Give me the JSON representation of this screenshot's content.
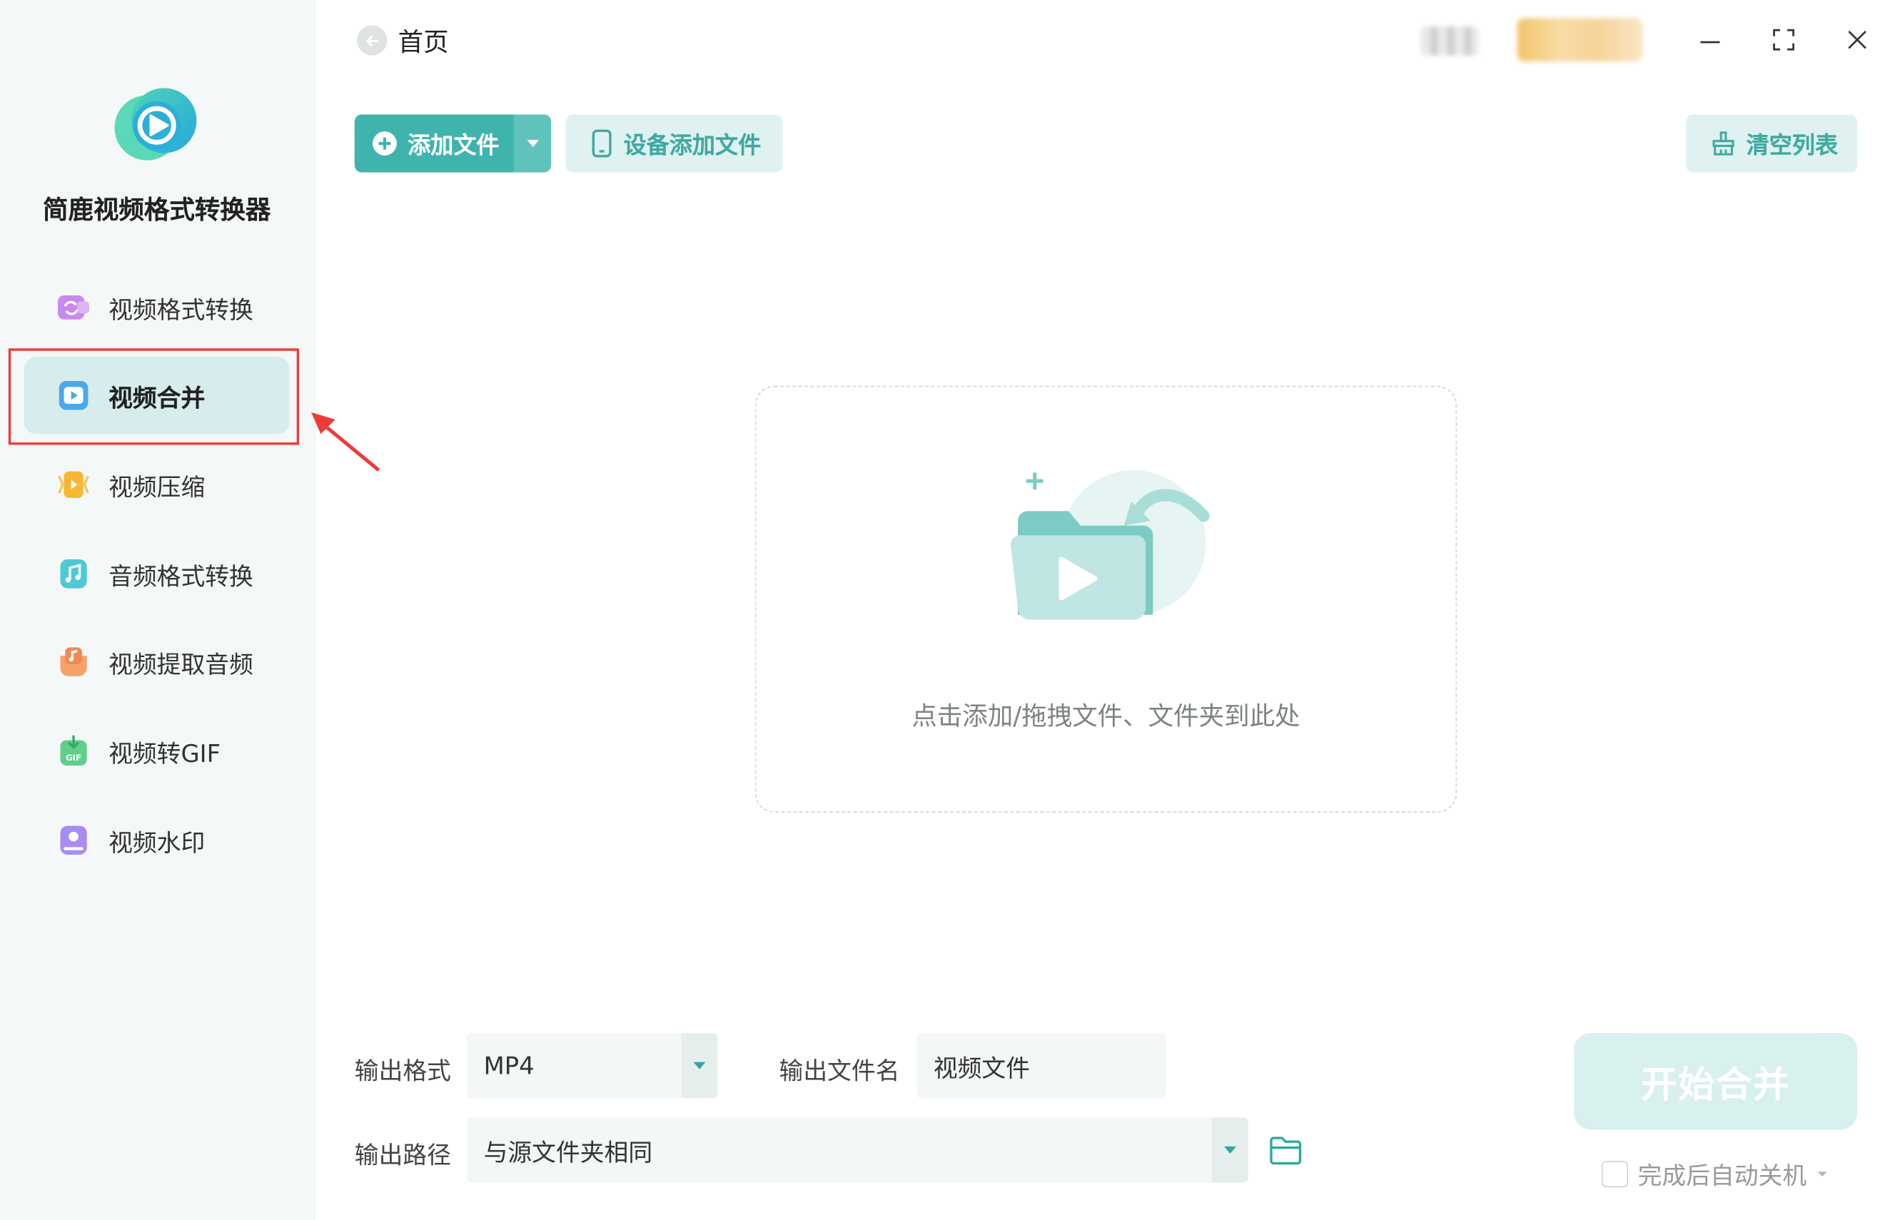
{
  "app": {
    "name": "简鹿视频格式转换器"
  },
  "nav": {
    "items": [
      {
        "label": "视频格式转换",
        "icon": "video-convert-icon"
      },
      {
        "label": "视频合并",
        "icon": "video-merge-icon",
        "active": true
      },
      {
        "label": "视频压缩",
        "icon": "video-compress-icon"
      },
      {
        "label": "音频格式转换",
        "icon": "audio-convert-icon"
      },
      {
        "label": "视频提取音频",
        "icon": "extract-audio-icon"
      },
      {
        "label": "视频转GIF",
        "icon": "gif-icon"
      },
      {
        "label": "视频水印",
        "icon": "watermark-icon"
      }
    ]
  },
  "header": {
    "breadcrumb": "首页"
  },
  "toolbar": {
    "add_file": "添加文件",
    "device_add": "设备添加文件",
    "clear_list": "清空列表"
  },
  "dropzone": {
    "hint": "点击添加/拖拽文件、文件夹到此处"
  },
  "output": {
    "format_label": "输出格式",
    "format_value": "MP4",
    "filename_label": "输出文件名",
    "filename_value": "视频文件",
    "path_label": "输出路径",
    "path_value": "与源文件夹相同"
  },
  "actions": {
    "start": "开始合并",
    "shutdown_label": "完成后自动关机",
    "shutdown_checked": false
  },
  "colors": {
    "accent": "#3eb4ac",
    "accent_light": "#dff1f0",
    "highlight": "#f03a3a"
  }
}
